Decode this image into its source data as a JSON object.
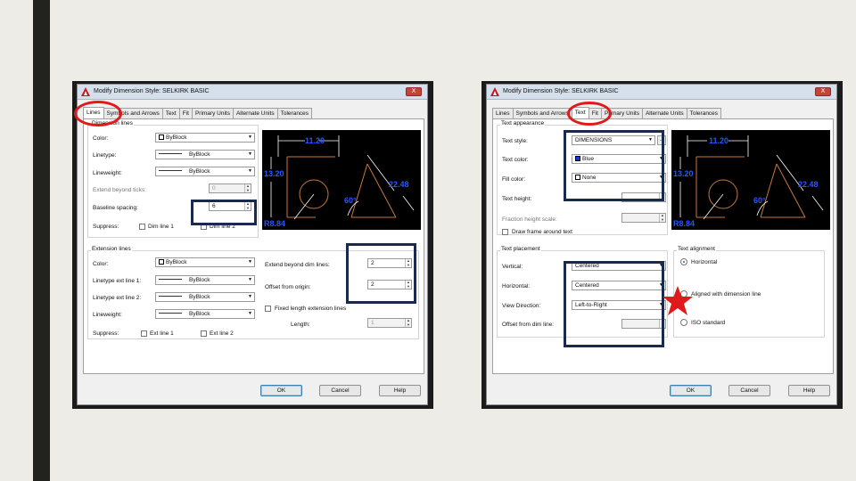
{
  "left_dialog": {
    "title": "Modify Dimension Style: SELKIRK BASIC",
    "close_label": "X",
    "tabs": [
      {
        "label": "Lines",
        "active": true
      },
      {
        "label": "Symbols and Arrows",
        "active": false
      },
      {
        "label": "Text",
        "active": false
      },
      {
        "label": "Fit",
        "active": false
      },
      {
        "label": "Primary Units",
        "active": false
      },
      {
        "label": "Alternate Units",
        "active": false
      },
      {
        "label": "Tolerances",
        "active": false
      }
    ],
    "dim_lines": {
      "group_label": "Dimension lines",
      "color_label": "Color:",
      "color_value": "ByBlock",
      "linetype_label": "Linetype:",
      "linetype_value": "ByBlock",
      "lineweight_label": "Lineweight:",
      "lineweight_value": "ByBlock",
      "extend_label": "Extend beyond ticks:",
      "extend_value": "0",
      "baseline_label": "Baseline spacing:",
      "baseline_value": "6",
      "suppress_label": "Suppress:",
      "dim1_label": "Dim line 1",
      "dim2_label": "Dim line 2"
    },
    "ext_lines": {
      "group_label": "Extension lines",
      "color_label": "Color:",
      "color_value": "ByBlock",
      "lt1_label": "Linetype ext line 1:",
      "lt1_value": "ByBlock",
      "lt2_label": "Linetype ext line 2:",
      "lt2_value": "ByBlock",
      "lineweight_label": "Lineweight:",
      "lineweight_value": "ByBlock",
      "suppress_label": "Suppress:",
      "ext1_label": "Ext line 1",
      "ext2_label": "Ext line 2",
      "extend_label": "Extend beyond dim lines:",
      "extend_value": "2",
      "offset_label": "Offset from origin:",
      "offset_value": "2",
      "fixed_label": "Fixed length extension lines",
      "length_label": "Length:",
      "length_value": "1"
    },
    "buttons": {
      "ok": "OK",
      "cancel": "Cancel",
      "help": "Help"
    }
  },
  "right_dialog": {
    "title": "Modify Dimension Style: SELKIRK BASIC",
    "close_label": "X",
    "tabs": [
      {
        "label": "Lines",
        "active": false
      },
      {
        "label": "Symbols and Arrows",
        "active": false
      },
      {
        "label": "Text",
        "active": true
      },
      {
        "label": "Fit",
        "active": false
      },
      {
        "label": "Primary Units",
        "active": false
      },
      {
        "label": "Alternate Units",
        "active": false
      },
      {
        "label": "Tolerances",
        "active": false
      }
    ],
    "appearance": {
      "group_label": "Text appearance",
      "style_label": "Text style:",
      "style_value": "DIMENSIONS",
      "style_button": "...",
      "color_label": "Text color:",
      "color_value": "Blue",
      "color_swatch": "#1636d8",
      "fill_label": "Fill color:",
      "fill_value": "None",
      "height_label": "Text height:",
      "fraction_label": "Fraction height scale:",
      "frame_label": "Draw frame around text"
    },
    "placement": {
      "group_label": "Text placement",
      "vertical_label": "Vertical:",
      "vertical_value": "Centered",
      "horizontal_label": "Horizontal:",
      "horizontal_value": "Centered",
      "direction_label": "View Direction:",
      "direction_value": "Left-to-Right",
      "offset_label": "Offset from dim line:"
    },
    "alignment": {
      "group_label": "Text alignment",
      "opt_horizontal": "Horizontal",
      "opt_aligned": "Aligned with dimension line",
      "opt_iso": "ISO standard"
    },
    "buttons": {
      "ok": "OK",
      "cancel": "Cancel",
      "help": "Help"
    }
  },
  "preview": {
    "top_dim": "11.20",
    "left_dim": "13.20",
    "right_dim": "22.48",
    "angle_dim": "60°",
    "radius_dim": "R8.84"
  },
  "colors": {
    "highlight_rect": "#1a2a4e",
    "highlight_oval": "#e01a1a",
    "star": "#e01a1a",
    "preview_text": "#2a56ff",
    "preview_geometry": "#c8783a"
  }
}
